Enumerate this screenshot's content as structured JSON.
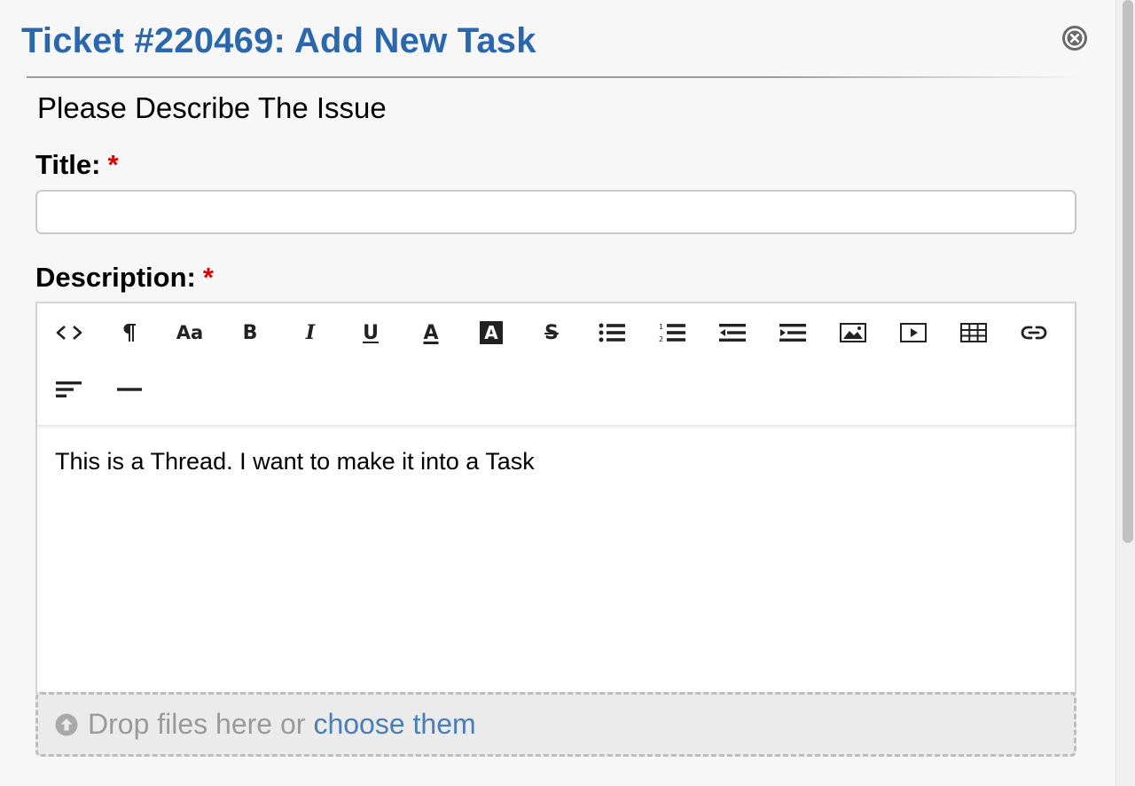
{
  "dialog": {
    "title": "Ticket #220469: Add New Task",
    "close_icon": "close-circle-icon"
  },
  "form": {
    "section_title": "Please Describe The Issue",
    "title_field": {
      "label": "Title:",
      "required_mark": "*",
      "value": "",
      "placeholder": ""
    },
    "description_field": {
      "label": "Description:",
      "required_mark": "*"
    }
  },
  "editor": {
    "toolbar": [
      {
        "name": "code-view-icon",
        "tooltip": "Code View"
      },
      {
        "name": "paragraph-icon",
        "tooltip": "Formatting"
      },
      {
        "name": "font-size-icon",
        "label": "Aa",
        "tooltip": "Font"
      },
      {
        "name": "bold-icon",
        "label": "B",
        "tooltip": "Bold"
      },
      {
        "name": "italic-icon",
        "label": "I",
        "tooltip": "Italic"
      },
      {
        "name": "underline-icon",
        "label": "U",
        "tooltip": "Underline"
      },
      {
        "name": "font-color-icon",
        "label": "A",
        "tooltip": "Font Color"
      },
      {
        "name": "background-color-icon",
        "label": "A",
        "tooltip": "Back Color"
      },
      {
        "name": "strikethrough-icon",
        "label": "S",
        "tooltip": "Deleted"
      },
      {
        "name": "unordered-list-icon",
        "tooltip": "Unordered List"
      },
      {
        "name": "ordered-list-icon",
        "tooltip": "Ordered List"
      },
      {
        "name": "outdent-icon",
        "tooltip": "Outdent"
      },
      {
        "name": "indent-icon",
        "tooltip": "Indent"
      },
      {
        "name": "image-icon",
        "tooltip": "Image"
      },
      {
        "name": "video-icon",
        "tooltip": "Video"
      },
      {
        "name": "table-icon",
        "tooltip": "Table"
      },
      {
        "name": "link-icon",
        "tooltip": "Link"
      },
      {
        "name": "align-icon",
        "tooltip": "Align"
      },
      {
        "name": "horizontal-rule-icon",
        "tooltip": "Insert Horizontal Rule"
      }
    ],
    "content": "This is a Thread. I want to make it into a Task"
  },
  "dropzone": {
    "icon": "upload-circle-icon",
    "text": "Drop files here or",
    "link_text": "choose them"
  }
}
